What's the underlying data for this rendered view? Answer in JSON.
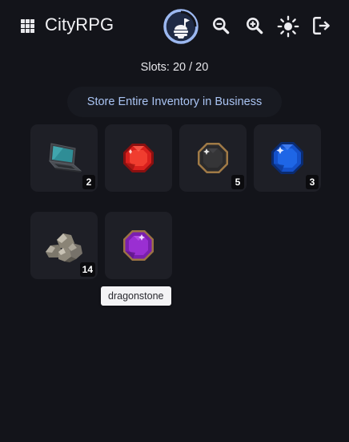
{
  "header": {
    "title": "CityRPG",
    "icons": {
      "menu": "grid-icon",
      "business": "business-icon",
      "zoom_out": "zoom-out-icon",
      "zoom_in": "zoom-in-icon",
      "theme": "sun-icon",
      "logout": "logout-icon"
    }
  },
  "inventory": {
    "slots_text": "Slots: 20 / 20",
    "store_button_label": "Store Entire Inventory in Business",
    "items": [
      {
        "icon": "laptop-icon",
        "quantity": "2"
      },
      {
        "icon": "ruby-icon",
        "quantity": ""
      },
      {
        "icon": "onyx-icon",
        "quantity": "5"
      },
      {
        "icon": "sapphire-icon",
        "quantity": "3"
      },
      {
        "icon": "stone-icon",
        "quantity": "14"
      },
      {
        "icon": "dragonstone-icon",
        "quantity": ""
      }
    ],
    "tooltip": "dragonstone"
  },
  "colors": {
    "background": "#13141a",
    "slot": "#1e1f26",
    "accent_text": "#a9c3f2",
    "business_ring": "#9cb8f0"
  }
}
